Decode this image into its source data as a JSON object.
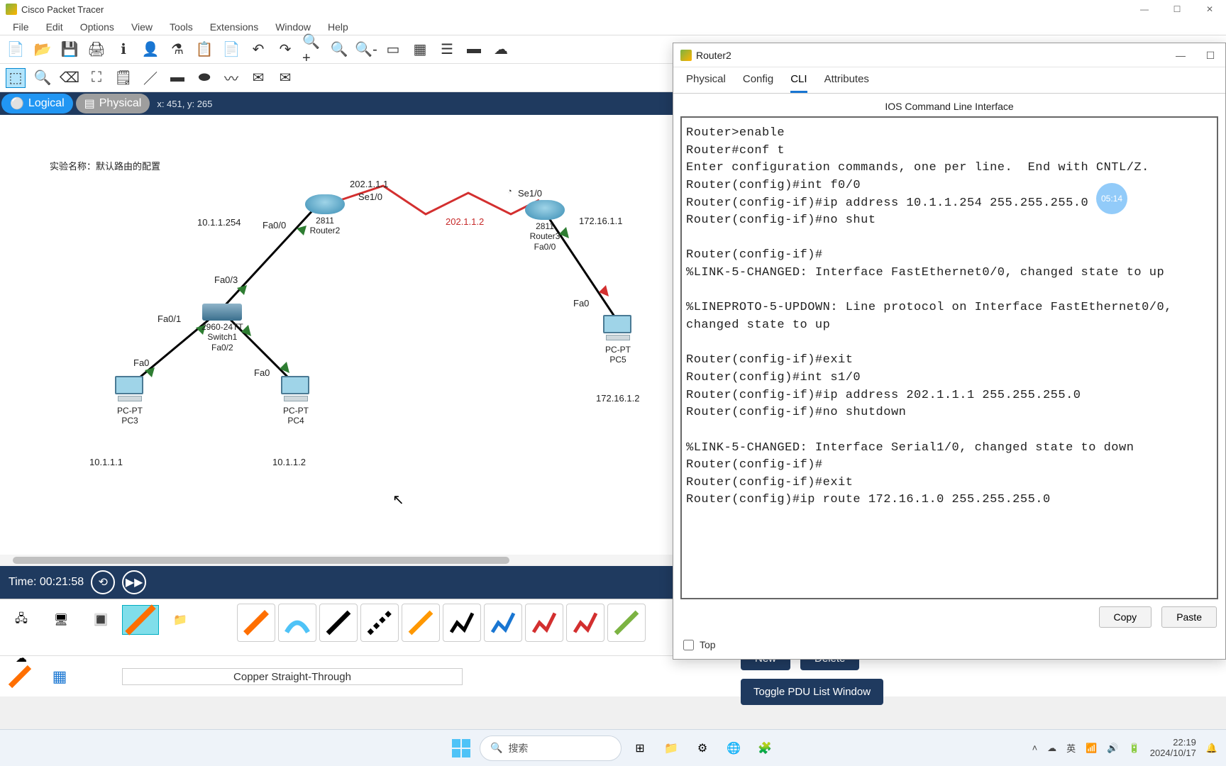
{
  "app": {
    "title": "Cisco Packet Tracer"
  },
  "menu": [
    "File",
    "Edit",
    "Options",
    "View",
    "Tools",
    "Extensions",
    "Window",
    "Help"
  ],
  "view": {
    "logical": "Logical",
    "physical": "Physical",
    "coords": "x: 451, y: 265"
  },
  "experiment_label": "实验名称：默认路由的配置",
  "labels": {
    "se10_r2": "202.1.1.1",
    "se10_r2_port": "Se1/0",
    "se10_r3_port": "Se1/0",
    "se_link_ip": "202.1.1.2",
    "r2_fa00": "Fa0/0",
    "r2_model": "2811",
    "r2_name": "Router2",
    "r2_lan_ip": "10.1.1.254",
    "r3_model": "2811",
    "r3_name": "Router3",
    "r3_fa00": "Fa0/0",
    "r3_lan_ip": "172.16.1.1",
    "sw_fa03": "Fa0/3",
    "sw_fa01": "Fa0/1",
    "sw_fa02": "Fa0/2",
    "sw_model": "2960-24TT",
    "sw_name": "Switch1",
    "pc3_fa0": "Fa0",
    "pc4_fa0": "Fa0",
    "pc5_fa0": "Fa0",
    "pc3_type": "PC-PT",
    "pc3_name": "PC3",
    "pc4_type": "PC-PT",
    "pc4_name": "PC4",
    "pc5_type": "PC-PT",
    "pc5_name": "PC5",
    "pc3_ip": "10.1.1.1",
    "pc4_ip": "10.1.1.2",
    "pc5_ip": "172.16.1.2"
  },
  "timebar": {
    "label": "Time: 00:21:58"
  },
  "connection_status": "Copper Straight-Through",
  "cli": {
    "window_title": "Router2",
    "tabs": [
      "Physical",
      "Config",
      "CLI",
      "Attributes"
    ],
    "active_tab": "CLI",
    "subtitle": "IOS Command Line Interface",
    "output": "Router>enable\nRouter#conf t\nEnter configuration commands, one per line.  End with CNTL/Z.\nRouter(config)#int f0/0\nRouter(config-if)#ip address 10.1.1.254 255.255.255.0\nRouter(config-if)#no shut\n\nRouter(config-if)#\n%LINK-5-CHANGED: Interface FastEthernet0/0, changed state to up\n\n%LINEPROTO-5-UPDOWN: Line protocol on Interface FastEthernet0/0, changed state to up\n\nRouter(config-if)#exit\nRouter(config)#int s1/0\nRouter(config-if)#ip address 202.1.1.1 255.255.255.0\nRouter(config-if)#no shutdown\n\n%LINK-5-CHANGED: Interface Serial1/0, changed state to down\nRouter(config-if)#\nRouter(config-if)#exit\nRouter(config)#ip route 172.16.1.0 255.255.255.0 ",
    "copy": "Copy",
    "paste": "Paste",
    "top": "Top"
  },
  "pdu": {
    "new": "New",
    "delete": "Delete",
    "toggle": "Toggle PDU List Window"
  },
  "timer_badge": "05:14",
  "taskbar": {
    "search_placeholder": "搜索",
    "ime": "英",
    "time": "22:19",
    "date": "2024/10/17"
  }
}
